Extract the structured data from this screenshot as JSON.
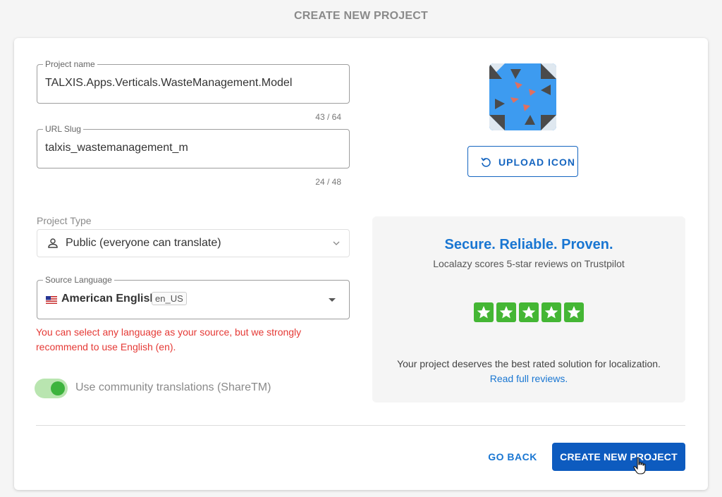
{
  "header": {
    "title": "CREATE NEW PROJECT"
  },
  "form": {
    "project_name": {
      "label": "Project name",
      "value": "TALXIS.Apps.Verticals.WasteManagement.Model",
      "counter": "43 / 64"
    },
    "url_slug": {
      "label": "URL Slug",
      "value": "talxis_wastemanagement_m",
      "counter": "24 / 48"
    },
    "project_type": {
      "label": "Project Type",
      "selected": "Public (everyone can translate)",
      "icon": "person-icon"
    },
    "source_language": {
      "label": "Source Language",
      "name": "American English",
      "code": "en_US",
      "flag": "us-flag-icon"
    },
    "warning": "You can select any language as your source, but we strongly recommend to use English (en).",
    "community": {
      "label": "Use community translations (ShareTM)",
      "enabled": true
    }
  },
  "icon_panel": {
    "upload_label": "UPLOAD ICON"
  },
  "promo": {
    "title": "Secure. Reliable. Proven.",
    "subtitle": "Localazy scores 5-star reviews on Trustpilot",
    "rating": 5,
    "text": "Your project deserves the best rated solution for localization.",
    "link": "Read full reviews."
  },
  "footer": {
    "back_label": "GO BACK",
    "create_label": "CREATE NEW PROJECT"
  },
  "colors": {
    "accent": "#1976d2",
    "primary_button": "#0d5bbf",
    "warning": "#e53935",
    "star_green": "#44b634",
    "toggle_on": "#3db33d"
  }
}
